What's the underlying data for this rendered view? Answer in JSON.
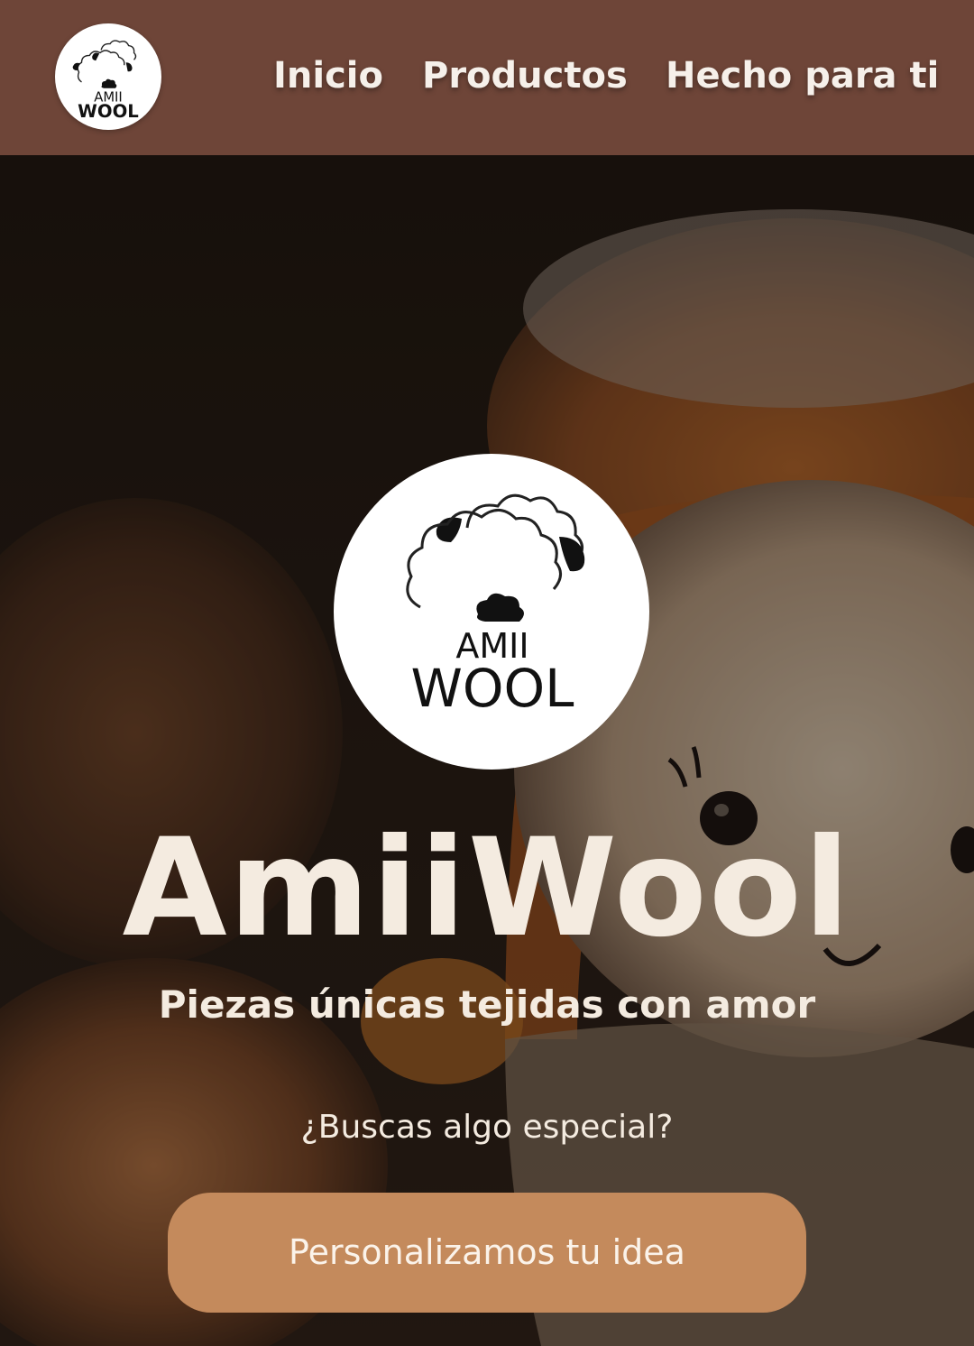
{
  "header": {
    "logo": {
      "line1": "AMII",
      "line2": "WOOL",
      "icon": "sheep-logo-icon"
    },
    "nav": [
      {
        "label": "Inicio"
      },
      {
        "label": "Productos"
      },
      {
        "label": "Hecho para ti"
      }
    ],
    "background_color": "#6e4538"
  },
  "hero": {
    "logo": {
      "line1": "AMII",
      "line2": "WOOL",
      "icon": "sheep-logo-icon"
    },
    "title": "AmiiWool",
    "subtitle": "Piezas únicas tejidas con amor",
    "question": "¿Buscas algo especial?",
    "cta_label": "Personalizamos tu idea",
    "cta_color": "#c48a5c",
    "text_color": "#f4ebe0"
  }
}
